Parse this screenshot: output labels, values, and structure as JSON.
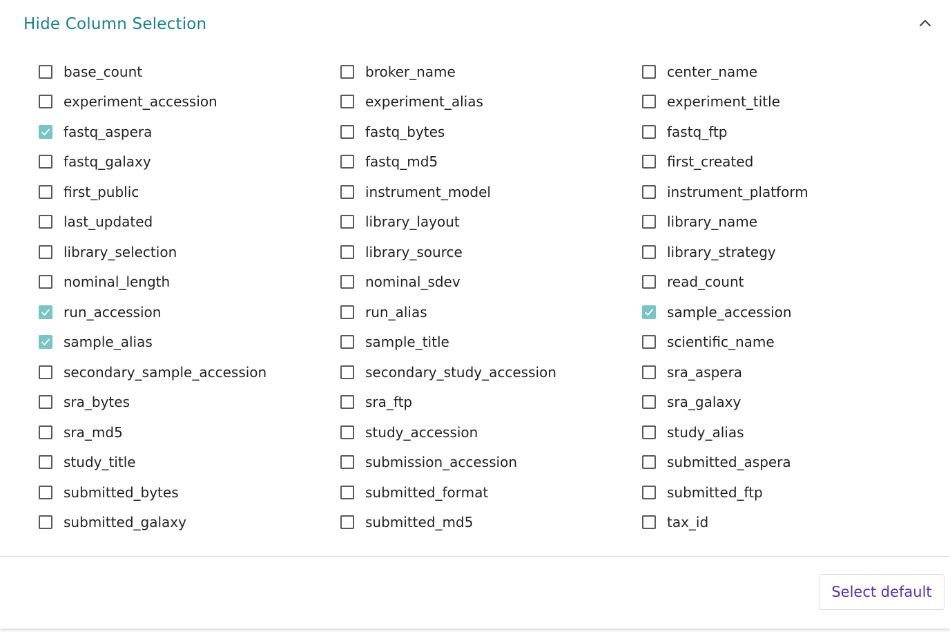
{
  "header": {
    "title": "Hide Column Selection",
    "collapse_icon": "chevron-up-icon"
  },
  "colors": {
    "title": "#1a8285",
    "checkbox_checked": "#79c4c5",
    "button_text": "#5a32a8"
  },
  "columns": [
    {
      "name": "base_count",
      "checked": false
    },
    {
      "name": "broker_name",
      "checked": false
    },
    {
      "name": "center_name",
      "checked": false
    },
    {
      "name": "experiment_accession",
      "checked": false
    },
    {
      "name": "experiment_alias",
      "checked": false
    },
    {
      "name": "experiment_title",
      "checked": false
    },
    {
      "name": "fastq_aspera",
      "checked": true
    },
    {
      "name": "fastq_bytes",
      "checked": false
    },
    {
      "name": "fastq_ftp",
      "checked": false
    },
    {
      "name": "fastq_galaxy",
      "checked": false
    },
    {
      "name": "fastq_md5",
      "checked": false
    },
    {
      "name": "first_created",
      "checked": false
    },
    {
      "name": "first_public",
      "checked": false
    },
    {
      "name": "instrument_model",
      "checked": false
    },
    {
      "name": "instrument_platform",
      "checked": false
    },
    {
      "name": "last_updated",
      "checked": false
    },
    {
      "name": "library_layout",
      "checked": false
    },
    {
      "name": "library_name",
      "checked": false
    },
    {
      "name": "library_selection",
      "checked": false
    },
    {
      "name": "library_source",
      "checked": false
    },
    {
      "name": "library_strategy",
      "checked": false
    },
    {
      "name": "nominal_length",
      "checked": false
    },
    {
      "name": "nominal_sdev",
      "checked": false
    },
    {
      "name": "read_count",
      "checked": false
    },
    {
      "name": "run_accession",
      "checked": true
    },
    {
      "name": "run_alias",
      "checked": false
    },
    {
      "name": "sample_accession",
      "checked": true
    },
    {
      "name": "sample_alias",
      "checked": true
    },
    {
      "name": "sample_title",
      "checked": false
    },
    {
      "name": "scientific_name",
      "checked": false
    },
    {
      "name": "secondary_sample_accession",
      "checked": false
    },
    {
      "name": "secondary_study_accession",
      "checked": false
    },
    {
      "name": "sra_aspera",
      "checked": false
    },
    {
      "name": "sra_bytes",
      "checked": false
    },
    {
      "name": "sra_ftp",
      "checked": false
    },
    {
      "name": "sra_galaxy",
      "checked": false
    },
    {
      "name": "sra_md5",
      "checked": false
    },
    {
      "name": "study_accession",
      "checked": false
    },
    {
      "name": "study_alias",
      "checked": false
    },
    {
      "name": "study_title",
      "checked": false
    },
    {
      "name": "submission_accession",
      "checked": false
    },
    {
      "name": "submitted_aspera",
      "checked": false
    },
    {
      "name": "submitted_bytes",
      "checked": false
    },
    {
      "name": "submitted_format",
      "checked": false
    },
    {
      "name": "submitted_ftp",
      "checked": false
    },
    {
      "name": "submitted_galaxy",
      "checked": false
    },
    {
      "name": "submitted_md5",
      "checked": false
    },
    {
      "name": "tax_id",
      "checked": false
    }
  ],
  "footer": {
    "select_default_label": "Select default"
  }
}
